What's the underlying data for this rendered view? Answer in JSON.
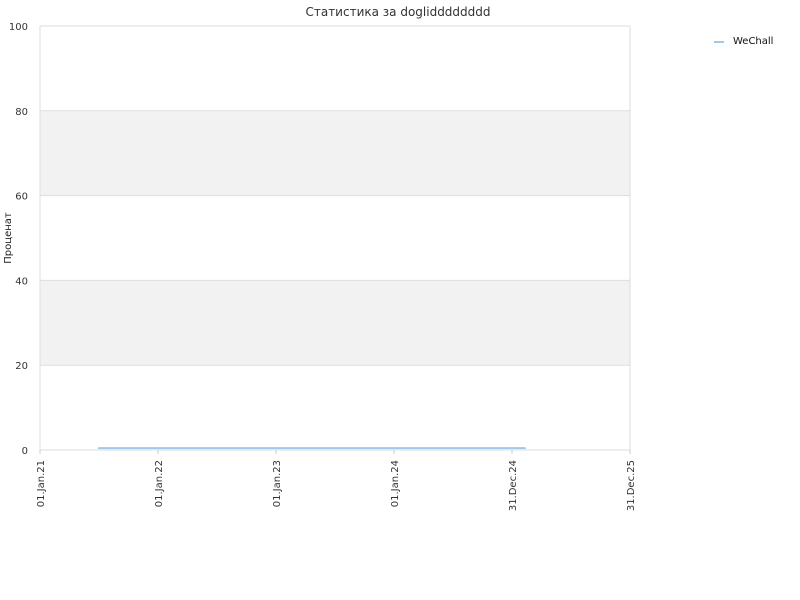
{
  "chart_data": {
    "type": "line",
    "title": "Статистика за doglidddddddd",
    "xlabel": "",
    "ylabel": "Проценат",
    "ylim": [
      0,
      100
    ],
    "yticks": [
      0,
      20,
      40,
      60,
      80,
      100
    ],
    "xlim": [
      "2021-01-01",
      "2025-12-31"
    ],
    "xticks": [
      {
        "date": "2021-01-01",
        "label": "01.Jan.21"
      },
      {
        "date": "2022-01-01",
        "label": "01.Jan.22"
      },
      {
        "date": "2023-01-01",
        "label": "01.Jan.23"
      },
      {
        "date": "2024-01-01",
        "label": "01.Jan.24"
      },
      {
        "date": "2024-12-31",
        "label": "31.Dec.24"
      },
      {
        "date": "2025-12-31",
        "label": "31.Dec.25"
      }
    ],
    "grid": true,
    "alternating_bands": true,
    "legend_position": "top-right",
    "series": [
      {
        "name": "WeChall",
        "color": "#9ec9ec",
        "points": [
          {
            "x": "2021-07-01",
            "y": 0.2
          },
          {
            "x": "2025-02-10",
            "y": 0.2
          }
        ]
      }
    ]
  }
}
